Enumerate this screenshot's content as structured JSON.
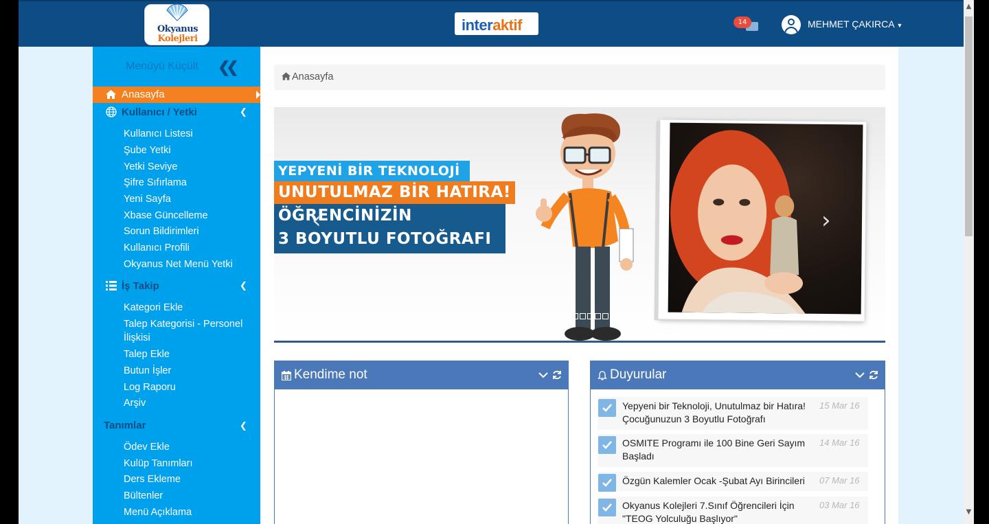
{
  "header": {
    "brand_line1": "Okyanus",
    "brand_line2": "Kolejleri",
    "product_logo_a": "inter",
    "product_logo_b": "aktif",
    "message_count": "14",
    "user_name": "MEHMET ÇAKIRCA",
    "colors": {
      "topbar": "#0e4c86",
      "accent": "#f4801f",
      "sidebar": "#00a1ec"
    }
  },
  "sidebar": {
    "collapse_label": "Menüyü Küçült",
    "active_item": "Anasayfa",
    "groups": [
      {
        "title": "Kullanıcı / Yetki",
        "icon": "globe-icon",
        "items": [
          "Kullanıcı Listesi",
          "Şube Yetki",
          "Yetki Seviye",
          "Şifre Sıfırlama",
          "Yeni Sayfa",
          "Xbase Güncelleme",
          "Sorun Bildirimleri",
          "Kullanıcı Profili",
          "Okyanus Net Menü Yetki"
        ]
      },
      {
        "title": "İş Takip",
        "icon": "list-icon",
        "items": [
          "Kategori Ekle",
          "Talep Kategorisi - Personel",
          "İlişkisi",
          "Talep Ekle",
          "Butun İşler",
          "Log Raporu",
          "Arşiv"
        ]
      },
      {
        "title": "Tanımlar",
        "icon": "",
        "items": [
          "Ödev Ekle",
          "Kulüp Tanımları",
          "Ders Ekleme",
          "Bültenler",
          "Menü Açıklama"
        ]
      }
    ]
  },
  "breadcrumb": {
    "home": "Anasayfa"
  },
  "carousel": {
    "lines": [
      "YEPYENİ BİR TEKNOLOJİ",
      "UNUTULMAZ BİR HATIRA!",
      "ÖĞRENCİNİZİN",
      "3 BOYUTLU FOTOĞRAFI"
    ],
    "prev_glyph": "‹",
    "next_glyph": "›"
  },
  "panels": {
    "note": {
      "title": "Kendime not"
    },
    "news": {
      "title": "Duyurular",
      "items": [
        {
          "text": "Yepyeni bir Teknoloji, Unutulmaz bir Hatıra! Çocuğunuzun 3 Boyutlu Fotoğrafı",
          "date": "15 Mar 16"
        },
        {
          "text": "OSMITE Programı ile 100 Bine Geri Sayım Başladı",
          "date": "14 Mar 16"
        },
        {
          "text": "Özgün Kalemler Ocak -Şubat Ayı Birincileri",
          "date": "07 Mar 16"
        },
        {
          "text": "Okyanus Kolejleri 7.Sınıf Öğrencileri İçin \"TEOG Yolculuğu Başlıyor\"",
          "date": "03 Mar 16"
        }
      ]
    }
  }
}
